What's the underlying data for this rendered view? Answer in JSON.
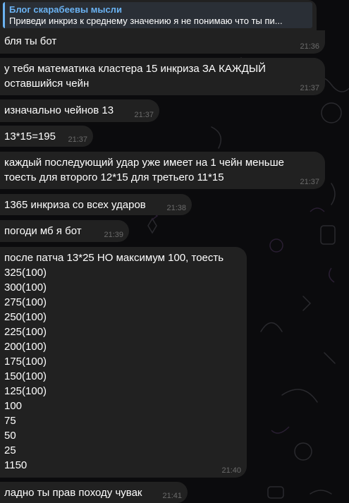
{
  "reply": {
    "channel": "Блог скарабеевы мысли",
    "quote": "Приведи инкриз к среднему значению я не понимаю что ты пи..."
  },
  "messages": [
    {
      "text": "бля ты бот",
      "time": "21:36"
    },
    {
      "text": "у тебя математика кластера 15 инкриза ЗА КАЖДЫЙ\nоставшийся чейн",
      "time": "21:37"
    },
    {
      "text": "изначально чейнов 13",
      "time": "21:37"
    },
    {
      "text": "13*15=195",
      "time": "21:37"
    },
    {
      "text": "каждый последующий удар уже имеет на 1 чейн меньше\nтоесть для второго 12*15 для третьего 11*15",
      "time": "21:37"
    },
    {
      "text": "1365 инкриза со всех ударов",
      "time": "21:38"
    },
    {
      "text": "погоди мб я бот",
      "time": "21:39"
    },
    {
      "text": "после патча 13*25 НО максимум 100, тоесть\n325(100)\n300(100)\n275(100)\n250(100)\n225(100)\n200(100)\n175(100)\n150(100)\n125(100)\n100\n75\n50\n25\n1150",
      "time": "21:40"
    },
    {
      "text": "ладно ты прав походу чувак",
      "time": "21:41"
    }
  ]
}
